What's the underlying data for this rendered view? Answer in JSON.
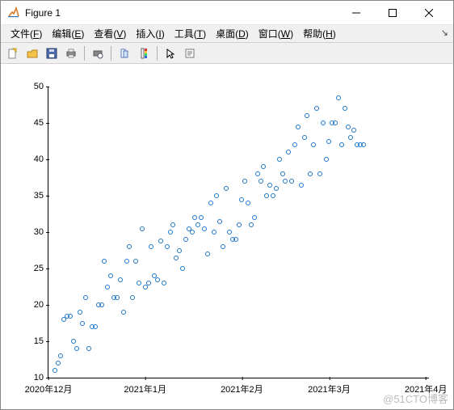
{
  "window": {
    "title": "Figure 1"
  },
  "menu": {
    "items": [
      {
        "label": "文件",
        "accel": "F"
      },
      {
        "label": "编辑",
        "accel": "E"
      },
      {
        "label": "查看",
        "accel": "V"
      },
      {
        "label": "插入",
        "accel": "I"
      },
      {
        "label": "工具",
        "accel": "T"
      },
      {
        "label": "桌面",
        "accel": "D"
      },
      {
        "label": "窗口",
        "accel": "W"
      },
      {
        "label": "帮助",
        "accel": "H"
      }
    ]
  },
  "toolbar": {
    "icons": [
      "new",
      "open",
      "save",
      "print",
      "sep",
      "print-preview",
      "sep",
      "link",
      "colorbar",
      "sep",
      "pointer",
      "edit-plot"
    ]
  },
  "chart_data": {
    "type": "scatter",
    "xlabel": "",
    "ylabel": "",
    "title": "",
    "xlim": [
      0,
      122
    ],
    "ylim": [
      10,
      50
    ],
    "xticks": [
      {
        "v": 0,
        "label": "2020年12月"
      },
      {
        "v": 31,
        "label": "2021年1月"
      },
      {
        "v": 62,
        "label": "2021年2月"
      },
      {
        "v": 90,
        "label": "2021年3月"
      },
      {
        "v": 121,
        "label": "2021年4月"
      }
    ],
    "yticks": [
      10,
      15,
      20,
      25,
      30,
      35,
      40,
      45,
      50
    ],
    "x": [
      2,
      3,
      4,
      5,
      6,
      7,
      8,
      9,
      10,
      11,
      12,
      13,
      14,
      15,
      16,
      17,
      18,
      19,
      20,
      21,
      22,
      23,
      24,
      25,
      26,
      27,
      28,
      29,
      30,
      31,
      32,
      33,
      34,
      35,
      36,
      37,
      38,
      39,
      40,
      41,
      42,
      43,
      44,
      45,
      46,
      47,
      48,
      49,
      50,
      51,
      52,
      53,
      54,
      55,
      56,
      57,
      58,
      59,
      60,
      61,
      62,
      63,
      64,
      65,
      66,
      67,
      68,
      69,
      70,
      71,
      72,
      73,
      74,
      75,
      76,
      77,
      78,
      79,
      80,
      81,
      82,
      83,
      84,
      85,
      86,
      87,
      88,
      89,
      90,
      91,
      92,
      93,
      94,
      95,
      96,
      97,
      98,
      99,
      100,
      101
    ],
    "y": [
      11,
      12,
      13,
      18,
      18.5,
      18.5,
      15,
      14,
      19,
      17.5,
      21,
      14,
      17,
      17,
      20,
      20,
      26,
      22.5,
      24,
      21,
      21,
      23.5,
      19,
      26,
      28,
      21,
      26,
      23,
      30.5,
      22.5,
      23,
      28,
      24,
      23.5,
      28.8,
      23,
      28,
      30,
      31,
      26.5,
      27.5,
      25,
      29,
      30.5,
      30,
      32,
      31,
      32,
      30.5,
      27,
      34,
      30,
      35,
      31.5,
      28,
      36,
      30,
      29,
      29,
      31,
      34.5,
      37,
      34,
      31,
      32,
      38,
      37,
      39,
      35,
      36.5,
      35,
      36,
      40,
      38,
      37,
      41,
      37,
      42,
      44.5,
      36.5,
      43,
      46,
      38,
      42,
      47,
      38,
      45,
      40,
      42.5,
      45,
      45,
      48.5,
      42,
      47,
      44.5,
      43,
      44,
      42,
      42,
      42
    ]
  },
  "watermark": "@51CTO博客"
}
